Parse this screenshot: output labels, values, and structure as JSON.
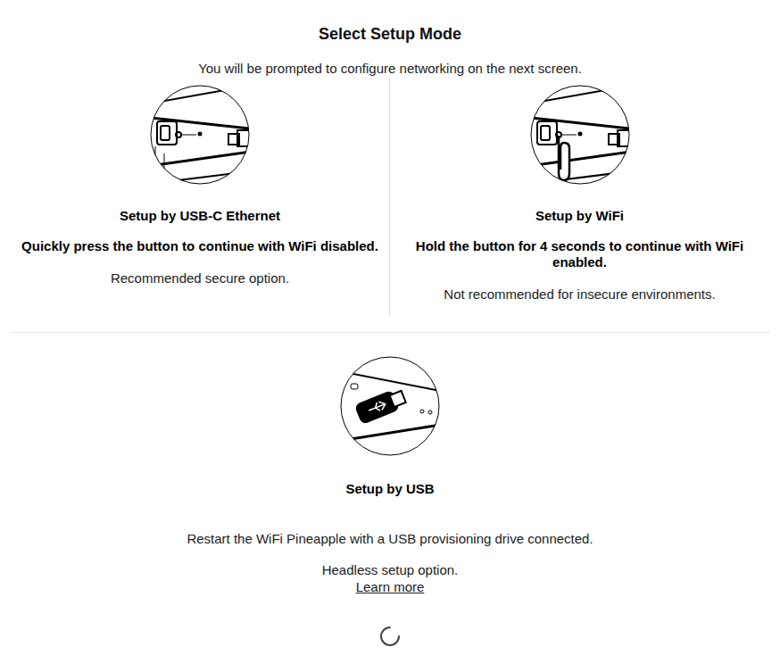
{
  "page": {
    "title": "Select Setup Mode",
    "subtitle": "You will be prompted to configure networking on the next screen."
  },
  "options": [
    {
      "title": "Setup by USB-C Ethernet",
      "instruction": "Quickly press the button to continue with WiFi disabled.",
      "note": "Recommended secure option.",
      "kind": "ethernet"
    },
    {
      "title": "Setup by WiFi",
      "instruction": "Hold the button for 4 seconds to continue with WiFi enabled.",
      "note": "Not recommended for insecure environments.",
      "kind": "wifi"
    }
  ],
  "usb": {
    "title": "Setup by USB",
    "text": "Restart the WiFi Pineapple with a USB provisioning drive connected.",
    "note": "Headless setup option.",
    "link": "Learn more"
  }
}
